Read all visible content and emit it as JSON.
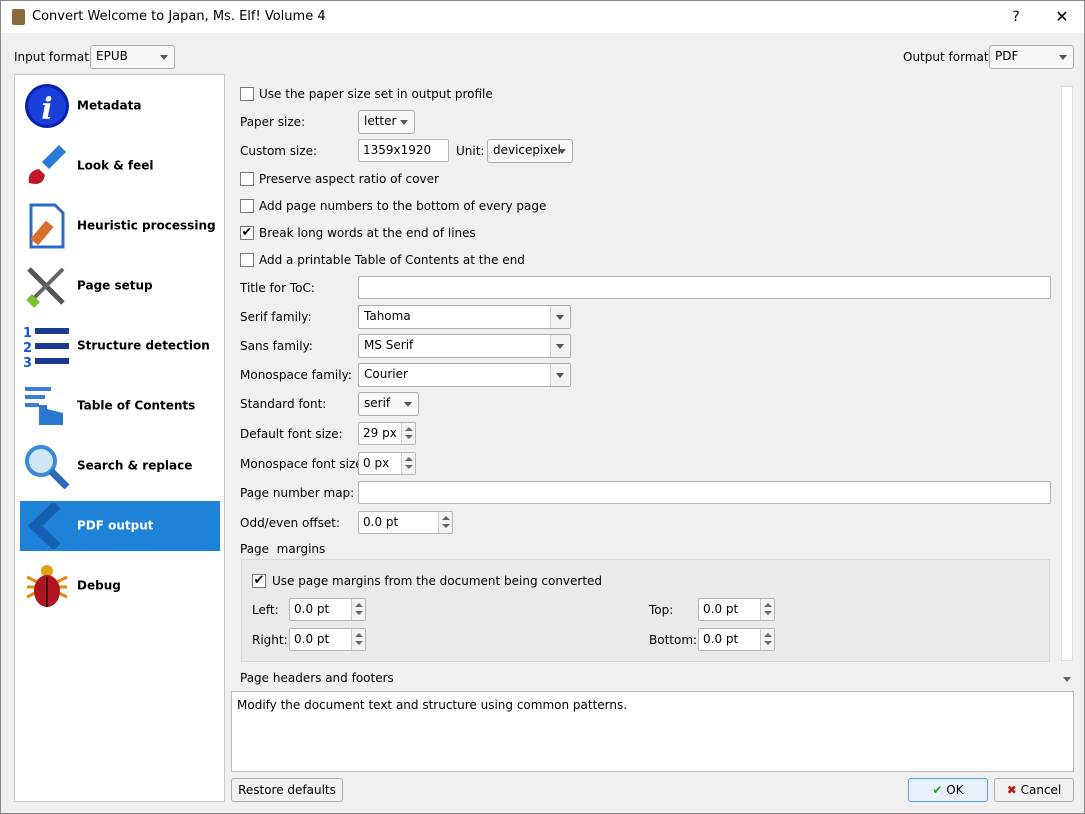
{
  "window": {
    "title": "Convert Welcome to Japan, Ms. Elf! Volume 4",
    "help": "?",
    "close": "✕"
  },
  "input_format": {
    "label": "Input format:",
    "value": "EPUB"
  },
  "output_format": {
    "label": "Output format:",
    "value": "PDF"
  },
  "sidebar": {
    "items": [
      {
        "label": "Metadata",
        "icon": "info-icon"
      },
      {
        "label": "Look & feel",
        "icon": "brush-icon"
      },
      {
        "label": "Heuristic processing",
        "icon": "document-icon"
      },
      {
        "label": "Page setup",
        "icon": "tools-icon"
      },
      {
        "label": "Structure detection",
        "icon": "numbered-list-icon"
      },
      {
        "label": "Table of Contents",
        "icon": "toc-hand-icon"
      },
      {
        "label": "Search & replace",
        "icon": "magnifier-icon"
      },
      {
        "label": "PDF output",
        "icon": "chevron-left-icon",
        "selected": true
      },
      {
        "label": "Debug",
        "icon": "bug-icon"
      }
    ]
  },
  "form": {
    "use_paper_size": {
      "label": "Use the paper size set in output profile",
      "checked": false
    },
    "paper_size": {
      "label": "Paper size:",
      "value": "letter"
    },
    "custom_size": {
      "label": "Custom size:",
      "value": "1359x1920"
    },
    "unit": {
      "label": "Unit:",
      "value": "devicepixel"
    },
    "preserve_aspect": {
      "label": "Preserve aspect ratio of cover",
      "checked": false
    },
    "page_numbers": {
      "label": "Add page numbers to the bottom of every page",
      "checked": false
    },
    "break_words": {
      "label": "Break long words at the end of lines",
      "checked": true
    },
    "printable_toc": {
      "label": "Add a printable Table of Contents at the end",
      "checked": false
    },
    "toc_title": {
      "label": "Title for ToC:",
      "value": ""
    },
    "serif_family": {
      "label": "Serif family:",
      "value": "Tahoma"
    },
    "sans_family": {
      "label": "Sans family:",
      "value": "MS Serif"
    },
    "mono_family": {
      "label": "Monospace family:",
      "value": "Courier"
    },
    "standard_font": {
      "label": "Standard font:",
      "value": "serif"
    },
    "default_font_size": {
      "label": "Default font size:",
      "value": "29 px"
    },
    "mono_font_size": {
      "label": "Monospace font size:",
      "value": "0 px"
    },
    "page_number_map": {
      "label": "Page number map:",
      "value": ""
    },
    "odd_even_offset": {
      "label": "Odd/even offset:",
      "value": "0.0 pt"
    },
    "page_margins": {
      "title": "Page  margins",
      "use_doc_margins": {
        "label": "Use page margins from the document being converted",
        "checked": true
      },
      "left": {
        "label": "Left:",
        "value": "0.0 pt"
      },
      "right": {
        "label": "Right:",
        "value": "0.0 pt"
      },
      "top": {
        "label": "Top:",
        "value": "0.0 pt"
      },
      "bottom": {
        "label": "Bottom:",
        "value": "0.0 pt"
      }
    },
    "headers_footers": {
      "title": "Page headers and footers"
    }
  },
  "description": "Modify the document text and structure using common patterns.",
  "buttons": {
    "restore": "Restore defaults",
    "ok": "OK",
    "cancel": "Cancel"
  }
}
